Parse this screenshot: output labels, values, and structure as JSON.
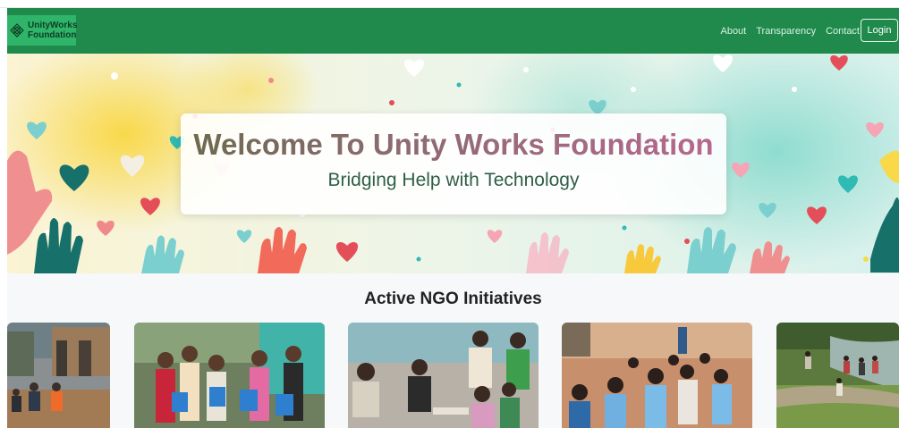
{
  "brand": {
    "line1": "UnityWorks",
    "line2": "Foundation",
    "icon": "lattice-logo-icon"
  },
  "nav": {
    "links": [
      "About",
      "Transparency",
      "Contact"
    ],
    "login": "Login"
  },
  "hero": {
    "title": "Welcome To Unity Works Foundation",
    "subtitle": "Bridging Help with Technology"
  },
  "initiatives": {
    "title": "Active NGO Initiatives",
    "cards": [
      {
        "scene": "flood-relief"
      },
      {
        "scene": "girls-with-books"
      },
      {
        "scene": "women-group"
      },
      {
        "scene": "children-classroom"
      },
      {
        "scene": "village-river"
      }
    ]
  },
  "colors": {
    "navbar": "#1f8a4c",
    "brand_bg": "#2fb56a",
    "section_bg": "#f7f8fa"
  }
}
